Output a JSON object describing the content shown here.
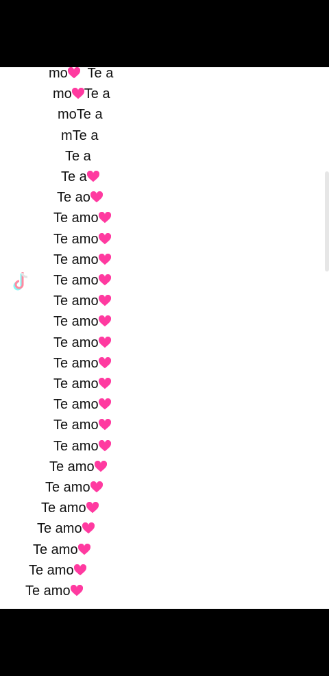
{
  "lines": [
    {
      "text": "mo",
      "heart": true,
      "after": "  Te a"
    },
    {
      "text": "mo",
      "heart": true,
      "after": "Te a"
    },
    {
      "text": "moTe a",
      "heart": false,
      "after": ""
    },
    {
      "text": "mTe a",
      "heart": false,
      "after": ""
    },
    {
      "text": "Te a",
      "heart": false,
      "after": ""
    },
    {
      "text": "Te a",
      "heart": true,
      "after": ""
    },
    {
      "text": "Te ao",
      "heart": true,
      "after": ""
    },
    {
      "text": "Te amo",
      "heart": true,
      "after": ""
    },
    {
      "text": "Te amo",
      "heart": true,
      "after": ""
    },
    {
      "text": "Te amo",
      "heart": true,
      "after": ""
    },
    {
      "text": "Te amo",
      "heart": true,
      "after": ""
    },
    {
      "text": "Te amo",
      "heart": true,
      "after": ""
    },
    {
      "text": "Te amo",
      "heart": true,
      "after": ""
    },
    {
      "text": "Te amo",
      "heart": true,
      "after": ""
    },
    {
      "text": "Te amo",
      "heart": true,
      "after": ""
    },
    {
      "text": "Te amo",
      "heart": true,
      "after": ""
    },
    {
      "text": "Te amo",
      "heart": true,
      "after": ""
    },
    {
      "text": "Te amo",
      "heart": true,
      "after": ""
    },
    {
      "text": "Te amo",
      "heart": true,
      "after": ""
    },
    {
      "text": "Te amo",
      "heart": true,
      "after": ""
    },
    {
      "text": "Te amo",
      "heart": true,
      "after": ""
    },
    {
      "text": "Te amo",
      "heart": true,
      "after": ""
    },
    {
      "text": "Te amo",
      "heart": true,
      "after": ""
    },
    {
      "text": "Te amo",
      "heart": true,
      "after": ""
    },
    {
      "text": "Te amo",
      "heart": true,
      "after": ""
    },
    {
      "text": "Te amo",
      "heart": true,
      "after": ""
    }
  ],
  "heart_color": "#ff3aa0",
  "watermark": {
    "icon": "tiktok-logo-icon"
  }
}
